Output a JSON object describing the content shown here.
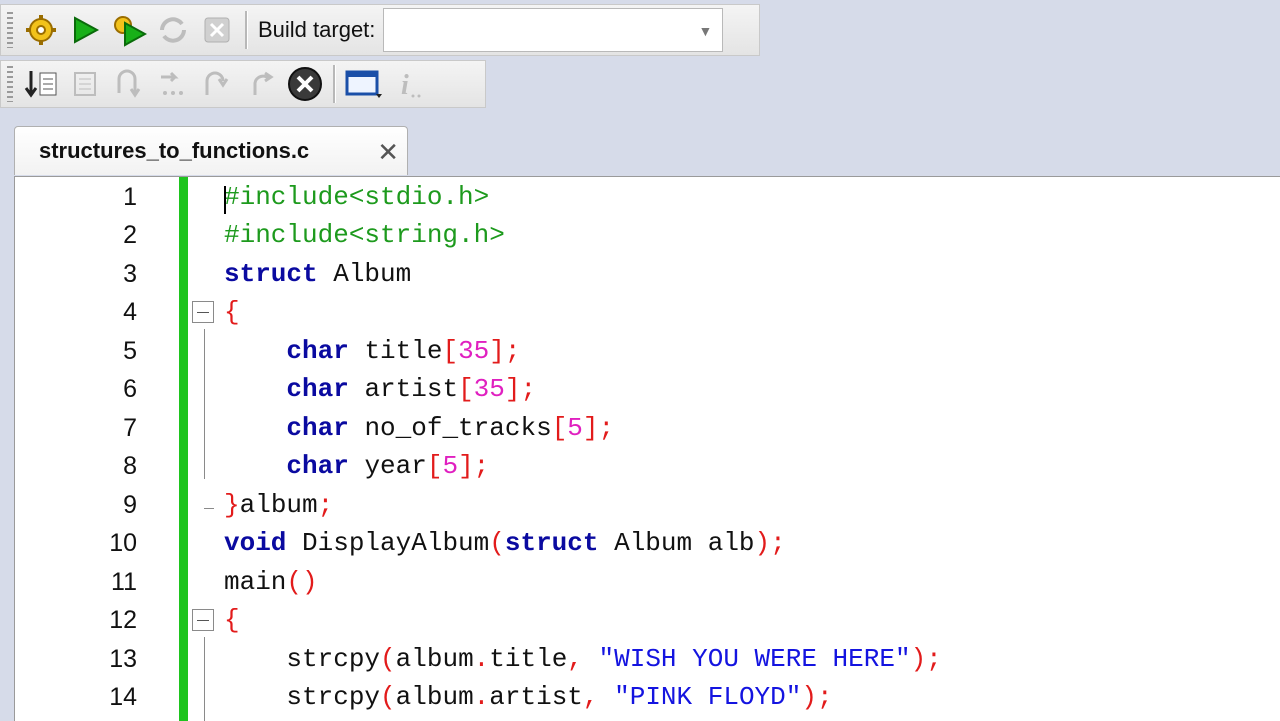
{
  "toolbar1": {
    "build_target_label": "Build target:",
    "build_target_value": "",
    "buttons": [
      "build-icon",
      "run-icon",
      "build-and-run-icon",
      "rebuild-icon",
      "abort-icon"
    ]
  },
  "toolbar2": {
    "buttons": [
      "run-to-cursor-icon",
      "debug-window-icon",
      "step-over-icon",
      "step-next-instruction-icon",
      "step-into-icon",
      "step-out-icon",
      "stop-debugger-icon",
      "debugging-windows-icon",
      "various-info-icon"
    ]
  },
  "tab": {
    "label": "structures_to_functions.c"
  },
  "editor": {
    "lines": [
      {
        "n": "1"
      },
      {
        "n": "2"
      },
      {
        "n": "3"
      },
      {
        "n": "4"
      },
      {
        "n": "5"
      },
      {
        "n": "6"
      },
      {
        "n": "7"
      },
      {
        "n": "8"
      },
      {
        "n": "9"
      },
      {
        "n": "10"
      },
      {
        "n": "11"
      },
      {
        "n": "12"
      },
      {
        "n": "13"
      },
      {
        "n": "14"
      }
    ],
    "code": {
      "l1": "#include<stdio.h>",
      "l2": "#include<string.h>",
      "l3_kw": "struct",
      "l3_rest": " Album",
      "l4": "{",
      "l5_kw": "char",
      "l5_id": " title",
      "l5_b1": "[",
      "l5_n": "35",
      "l5_b2": "];",
      "l6_kw": "char",
      "l6_id": " artist",
      "l6_b1": "[",
      "l6_n": "35",
      "l6_b2": "];",
      "l7_kw": "char",
      "l7_id": " no_of_tracks",
      "l7_b1": "[",
      "l7_n": "5",
      "l7_b2": "];",
      "l8_kw": "char",
      "l8_id": " year",
      "l8_b1": "[",
      "l8_n": "5",
      "l8_b2": "];",
      "l9_b": "}",
      "l9_id": "album",
      "l9_s": ";",
      "l10_kw1": "void",
      "l10_id1": " DisplayAlbum",
      "l10_p1": "(",
      "l10_kw2": "struct",
      "l10_id2": " Album alb",
      "l10_p2": ");",
      "l11_id": "main",
      "l11_p": "()",
      "l12": "{",
      "l13_id1": "strcpy",
      "l13_p1": "(",
      "l13_id2": "album",
      "l13_d": ".",
      "l13_id3": "title",
      "l13_c": ", ",
      "l13_s": "\"WISH YOU WERE HERE\"",
      "l13_p2": ");",
      "l14_id1": "strcpy",
      "l14_p1": "(",
      "l14_id2": "album",
      "l14_d": ".",
      "l14_id3": "artist",
      "l14_c": ", ",
      "l14_s": "\"PINK FLOYD\"",
      "l14_p2": ");"
    }
  },
  "colors": {
    "keyword": "#0a0aa0",
    "preprocessor": "#1d9a1d",
    "number": "#e020c0",
    "operator": "#e21b1b",
    "string": "#1414e0",
    "change_bar": "#1ec41e"
  }
}
